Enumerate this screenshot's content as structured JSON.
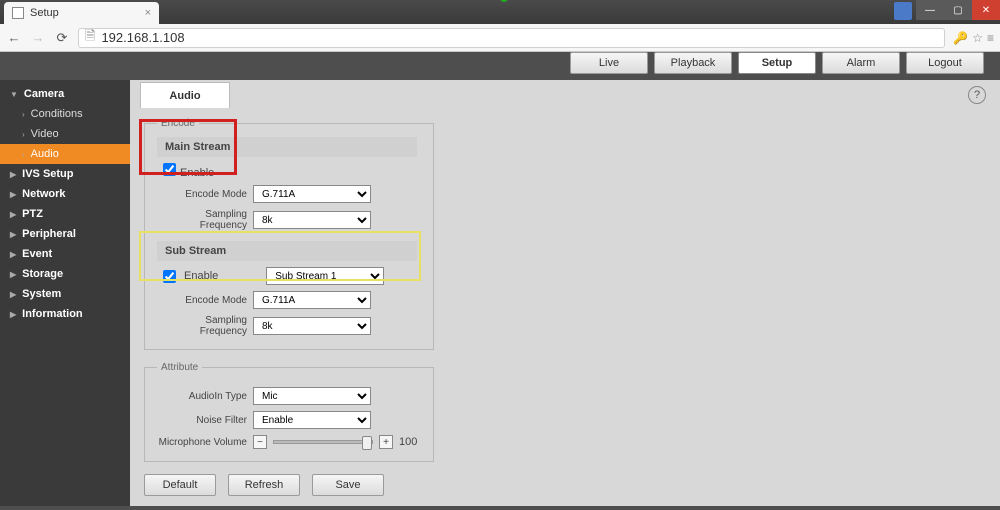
{
  "browser": {
    "tab_title": "Setup",
    "url": "192.168.1.108"
  },
  "header": {
    "buttons": [
      "Live",
      "Playback",
      "Setup",
      "Alarm",
      "Logout"
    ],
    "active": "Setup"
  },
  "sidebar": {
    "groups": [
      {
        "label": "Camera",
        "expanded": true,
        "children": [
          "Conditions",
          "Video",
          "Audio"
        ],
        "active_child": "Audio"
      },
      {
        "label": "IVS Setup",
        "expanded": false
      },
      {
        "label": "Network",
        "expanded": false
      },
      {
        "label": "PTZ",
        "expanded": false
      },
      {
        "label": "Peripheral",
        "expanded": false
      },
      {
        "label": "Event",
        "expanded": false
      },
      {
        "label": "Storage",
        "expanded": false
      },
      {
        "label": "System",
        "expanded": false
      },
      {
        "label": "Information",
        "expanded": false
      }
    ]
  },
  "content": {
    "tab": "Audio",
    "encode_legend": "Encode",
    "main_stream": {
      "title": "Main Stream",
      "enable_label": "Enable",
      "enable_checked": true,
      "encode_mode_label": "Encode Mode",
      "encode_mode_value": "G.711A",
      "sampling_label": "Sampling Frequency",
      "sampling_value": "8k"
    },
    "sub_stream": {
      "title": "Sub Stream",
      "enable_label": "Enable",
      "enable_checked": true,
      "stream_value": "Sub Stream 1",
      "encode_mode_label": "Encode Mode",
      "encode_mode_value": "G.711A",
      "sampling_label": "Sampling Frequency",
      "sampling_value": "8k"
    },
    "attribute_legend": "Attribute",
    "attribute": {
      "audioin_label": "AudioIn Type",
      "audioin_value": "Mic",
      "noise_label": "Noise Filter",
      "noise_value": "Enable",
      "mic_label": "Microphone Volume",
      "mic_value": 100
    },
    "buttons": {
      "default": "Default",
      "refresh": "Refresh",
      "save": "Save"
    }
  }
}
